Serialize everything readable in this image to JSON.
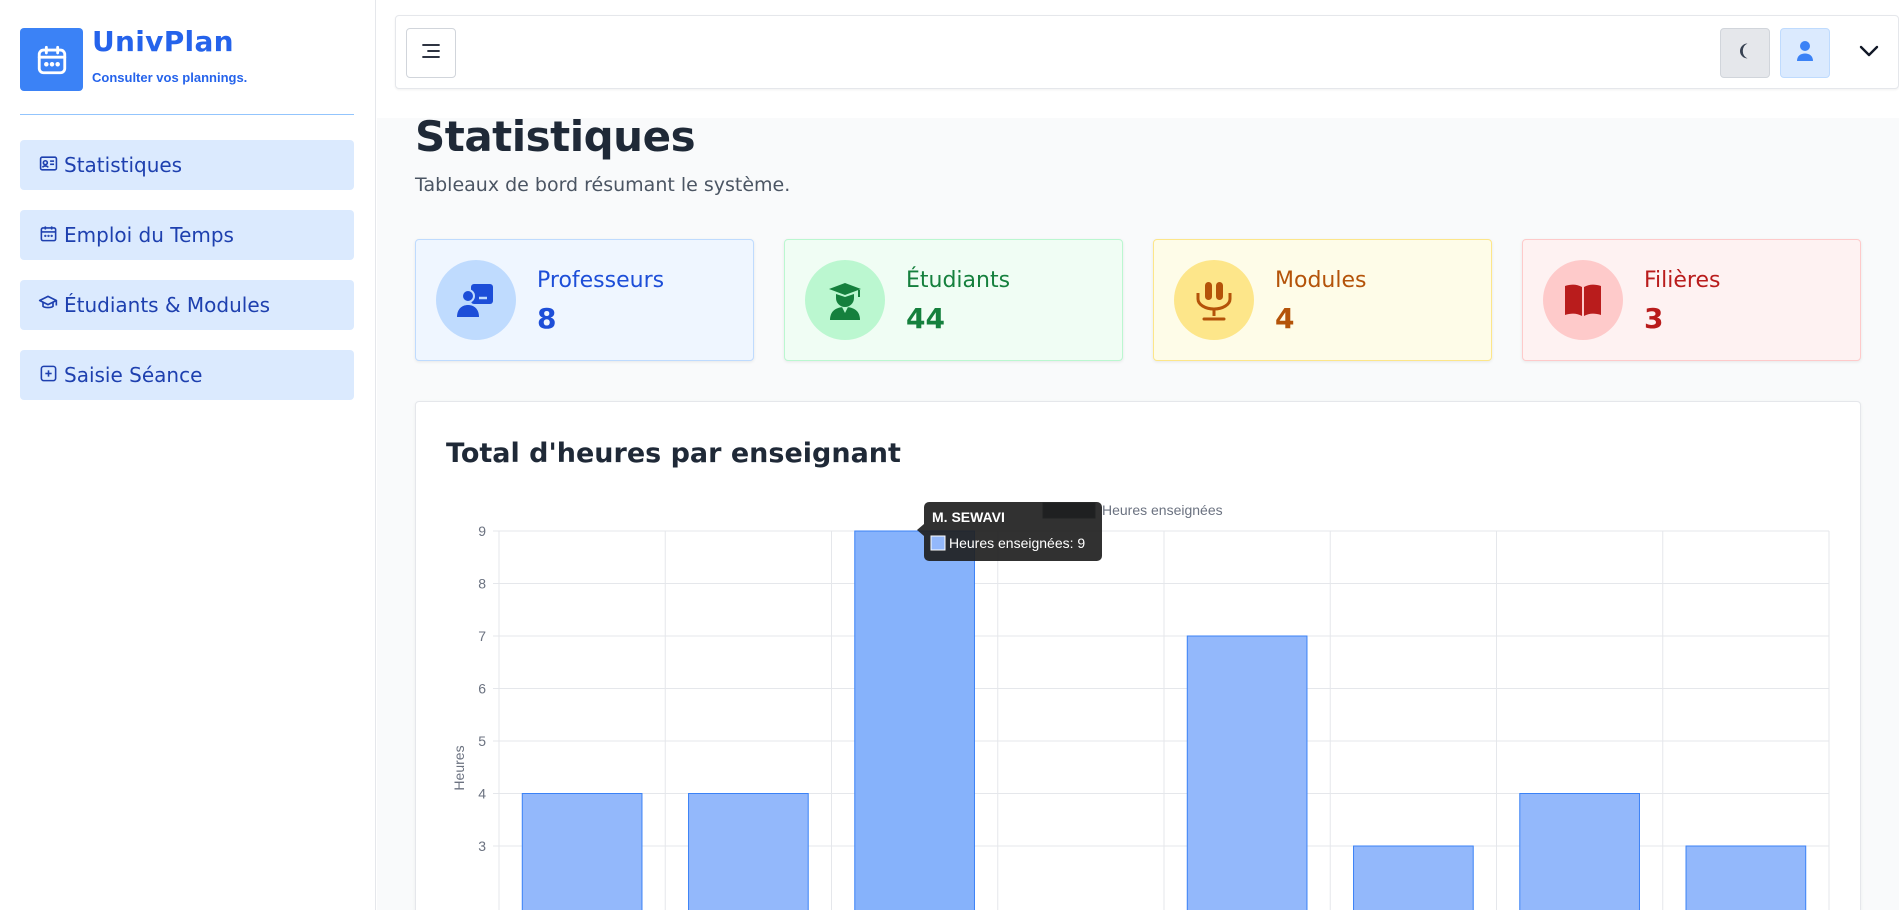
{
  "app": {
    "title": "UnivPlan",
    "subtitle": "Consulter vos plannings."
  },
  "sidebar": {
    "items": [
      {
        "label": "Statistiques",
        "icon": "id-card-icon"
      },
      {
        "label": "Emploi du Temps",
        "icon": "calendar-icon"
      },
      {
        "label": "Étudiants & Modules",
        "icon": "graduation-cap-icon"
      },
      {
        "label": "Saisie Séance",
        "icon": "add-square-icon"
      }
    ]
  },
  "topbar": {
    "menu_icon": "menu-icon",
    "theme_icon": "moon-icon",
    "user_icon": "user-icon",
    "chevron_icon": "chevron-down-icon"
  },
  "page": {
    "title": "Statistiques",
    "subtitle": "Tableaux de bord résumant le système."
  },
  "cards": [
    {
      "label": "Professeurs",
      "value": "8",
      "icon": "teacher-icon",
      "color": "#1d4ed8",
      "bg": "#eff6ff",
      "border": "#bfdbfe",
      "circle": "#bfdbfe"
    },
    {
      "label": "Étudiants",
      "value": "44",
      "icon": "student-icon",
      "color": "#15803d",
      "bg": "#f0fdf4",
      "border": "#bbf7d0",
      "circle": "#bbf7d0"
    },
    {
      "label": "Modules",
      "value": "4",
      "icon": "chair-icon",
      "color": "#b45309",
      "bg": "#fefce8",
      "border": "#fde68a",
      "circle": "#fde68a"
    },
    {
      "label": "Filières",
      "value": "3",
      "icon": "book-icon",
      "color": "#b91c1c",
      "bg": "#fef2f2",
      "border": "#fecaca",
      "circle": "#fecaca"
    }
  ],
  "chart": {
    "title": "Total d'heures par enseignant"
  },
  "chart_data": {
    "type": "bar",
    "title": "Total d'heures par enseignant",
    "ylabel": "Heures",
    "xlabel": "",
    "series": [
      {
        "name": "Heures enseignées",
        "values": [
          4,
          4,
          9,
          0,
          7,
          3,
          4,
          3
        ]
      }
    ],
    "highlight_index": 2,
    "ylim": [
      2,
      9
    ],
    "yticks": [
      3,
      4,
      5,
      6,
      7,
      8,
      9
    ],
    "legend": "top",
    "grid": true,
    "bar_color": "#93b8fb",
    "bar_highlight_color": "#86b2fb",
    "bar_border": "#3b82f6",
    "tooltip": {
      "title": "M. SEWAVI",
      "text": "Heures enseignées: 9"
    }
  }
}
